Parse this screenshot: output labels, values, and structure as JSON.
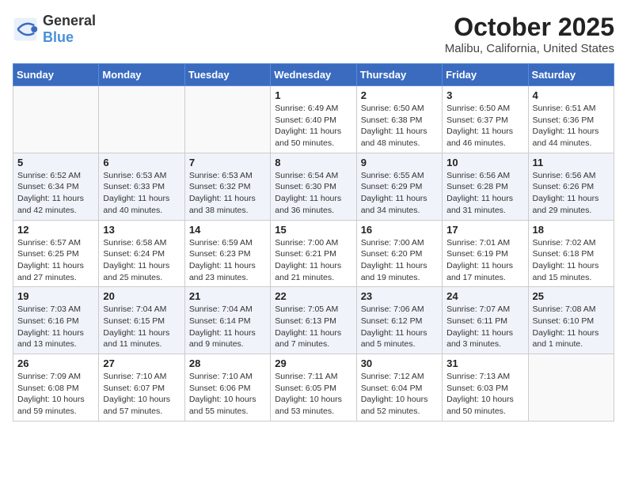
{
  "header": {
    "logo_line1": "General",
    "logo_line2": "Blue",
    "title": "October 2025",
    "subtitle": "Malibu, California, United States"
  },
  "days_of_week": [
    "Sunday",
    "Monday",
    "Tuesday",
    "Wednesday",
    "Thursday",
    "Friday",
    "Saturday"
  ],
  "weeks": [
    [
      {
        "day": "",
        "info": ""
      },
      {
        "day": "",
        "info": ""
      },
      {
        "day": "",
        "info": ""
      },
      {
        "day": "1",
        "info": "Sunrise: 6:49 AM\nSunset: 6:40 PM\nDaylight: 11 hours\nand 50 minutes."
      },
      {
        "day": "2",
        "info": "Sunrise: 6:50 AM\nSunset: 6:38 PM\nDaylight: 11 hours\nand 48 minutes."
      },
      {
        "day": "3",
        "info": "Sunrise: 6:50 AM\nSunset: 6:37 PM\nDaylight: 11 hours\nand 46 minutes."
      },
      {
        "day": "4",
        "info": "Sunrise: 6:51 AM\nSunset: 6:36 PM\nDaylight: 11 hours\nand 44 minutes."
      }
    ],
    [
      {
        "day": "5",
        "info": "Sunrise: 6:52 AM\nSunset: 6:34 PM\nDaylight: 11 hours\nand 42 minutes."
      },
      {
        "day": "6",
        "info": "Sunrise: 6:53 AM\nSunset: 6:33 PM\nDaylight: 11 hours\nand 40 minutes."
      },
      {
        "day": "7",
        "info": "Sunrise: 6:53 AM\nSunset: 6:32 PM\nDaylight: 11 hours\nand 38 minutes."
      },
      {
        "day": "8",
        "info": "Sunrise: 6:54 AM\nSunset: 6:30 PM\nDaylight: 11 hours\nand 36 minutes."
      },
      {
        "day": "9",
        "info": "Sunrise: 6:55 AM\nSunset: 6:29 PM\nDaylight: 11 hours\nand 34 minutes."
      },
      {
        "day": "10",
        "info": "Sunrise: 6:56 AM\nSunset: 6:28 PM\nDaylight: 11 hours\nand 31 minutes."
      },
      {
        "day": "11",
        "info": "Sunrise: 6:56 AM\nSunset: 6:26 PM\nDaylight: 11 hours\nand 29 minutes."
      }
    ],
    [
      {
        "day": "12",
        "info": "Sunrise: 6:57 AM\nSunset: 6:25 PM\nDaylight: 11 hours\nand 27 minutes."
      },
      {
        "day": "13",
        "info": "Sunrise: 6:58 AM\nSunset: 6:24 PM\nDaylight: 11 hours\nand 25 minutes."
      },
      {
        "day": "14",
        "info": "Sunrise: 6:59 AM\nSunset: 6:23 PM\nDaylight: 11 hours\nand 23 minutes."
      },
      {
        "day": "15",
        "info": "Sunrise: 7:00 AM\nSunset: 6:21 PM\nDaylight: 11 hours\nand 21 minutes."
      },
      {
        "day": "16",
        "info": "Sunrise: 7:00 AM\nSunset: 6:20 PM\nDaylight: 11 hours\nand 19 minutes."
      },
      {
        "day": "17",
        "info": "Sunrise: 7:01 AM\nSunset: 6:19 PM\nDaylight: 11 hours\nand 17 minutes."
      },
      {
        "day": "18",
        "info": "Sunrise: 7:02 AM\nSunset: 6:18 PM\nDaylight: 11 hours\nand 15 minutes."
      }
    ],
    [
      {
        "day": "19",
        "info": "Sunrise: 7:03 AM\nSunset: 6:16 PM\nDaylight: 11 hours\nand 13 minutes."
      },
      {
        "day": "20",
        "info": "Sunrise: 7:04 AM\nSunset: 6:15 PM\nDaylight: 11 hours\nand 11 minutes."
      },
      {
        "day": "21",
        "info": "Sunrise: 7:04 AM\nSunset: 6:14 PM\nDaylight: 11 hours\nand 9 minutes."
      },
      {
        "day": "22",
        "info": "Sunrise: 7:05 AM\nSunset: 6:13 PM\nDaylight: 11 hours\nand 7 minutes."
      },
      {
        "day": "23",
        "info": "Sunrise: 7:06 AM\nSunset: 6:12 PM\nDaylight: 11 hours\nand 5 minutes."
      },
      {
        "day": "24",
        "info": "Sunrise: 7:07 AM\nSunset: 6:11 PM\nDaylight: 11 hours\nand 3 minutes."
      },
      {
        "day": "25",
        "info": "Sunrise: 7:08 AM\nSunset: 6:10 PM\nDaylight: 11 hours\nand 1 minute."
      }
    ],
    [
      {
        "day": "26",
        "info": "Sunrise: 7:09 AM\nSunset: 6:08 PM\nDaylight: 10 hours\nand 59 minutes."
      },
      {
        "day": "27",
        "info": "Sunrise: 7:10 AM\nSunset: 6:07 PM\nDaylight: 10 hours\nand 57 minutes."
      },
      {
        "day": "28",
        "info": "Sunrise: 7:10 AM\nSunset: 6:06 PM\nDaylight: 10 hours\nand 55 minutes."
      },
      {
        "day": "29",
        "info": "Sunrise: 7:11 AM\nSunset: 6:05 PM\nDaylight: 10 hours\nand 53 minutes."
      },
      {
        "day": "30",
        "info": "Sunrise: 7:12 AM\nSunset: 6:04 PM\nDaylight: 10 hours\nand 52 minutes."
      },
      {
        "day": "31",
        "info": "Sunrise: 7:13 AM\nSunset: 6:03 PM\nDaylight: 10 hours\nand 50 minutes."
      },
      {
        "day": "",
        "info": ""
      }
    ]
  ]
}
